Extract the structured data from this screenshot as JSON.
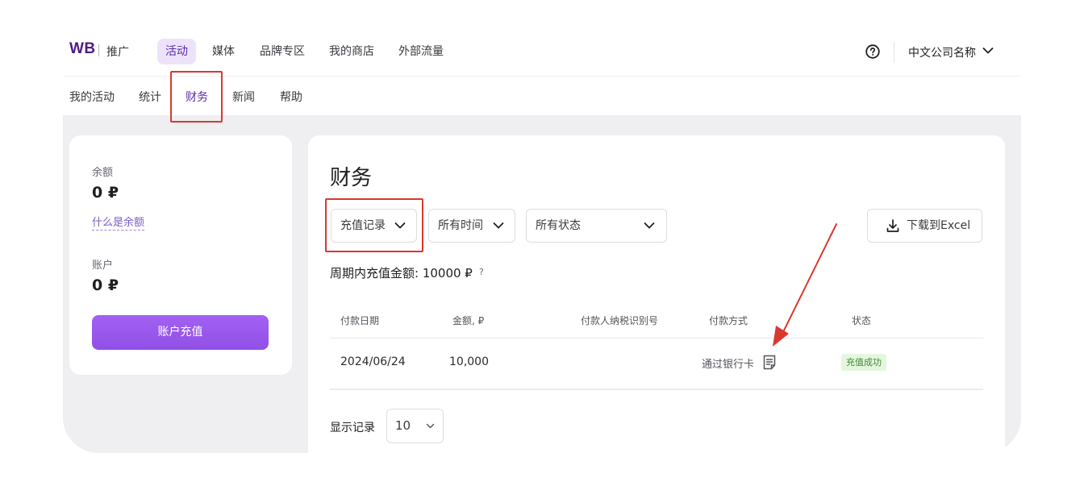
{
  "brand": {
    "logo": "WB",
    "sub": "推广"
  },
  "topnav": {
    "items": [
      {
        "label": "活动",
        "active": true
      },
      {
        "label": "媒体",
        "active": false
      },
      {
        "label": "品牌专区",
        "active": false
      },
      {
        "label": "我的商店",
        "active": false
      },
      {
        "label": "外部流量",
        "active": false
      }
    ],
    "help_icon": "question-circle-icon",
    "company": "中文公司名称",
    "company_icon": "chevron-down-icon"
  },
  "subnav": {
    "items": [
      {
        "label": "我的活动",
        "active": false
      },
      {
        "label": "统计",
        "active": false
      },
      {
        "label": "财务",
        "active": true
      },
      {
        "label": "新闻",
        "active": false
      },
      {
        "label": "帮助",
        "active": false
      }
    ]
  },
  "sidebar": {
    "balance_label": "余额",
    "balance_value": "0 ₽",
    "balance_link": "什么是余额",
    "account_label": "账户",
    "account_value": "0 ₽",
    "topup_button": "账户充值"
  },
  "finance": {
    "title": "财务",
    "filters": {
      "type": "充值记录",
      "time": "所有时间",
      "status": "所有状态"
    },
    "download_button": "下载到Excel",
    "download_icon": "download-icon",
    "period_total": "周期内充值金额: 10000 ₽",
    "period_help": "?",
    "table": {
      "headers": [
        "付款日期",
        "金额, ₽",
        "付款人纳税识别号",
        "付款方式",
        "状态"
      ],
      "rows": [
        {
          "date": "2024/06/24",
          "amount": "10,000",
          "tin": "",
          "method": "通过银行卡",
          "method_icon": "receipt-icon",
          "status": "充值成功"
        }
      ]
    },
    "page_size_label": "显示记录",
    "page_size": "10"
  },
  "colors": {
    "brand": "#4f1a86",
    "accent": "#9b59ee",
    "active_tab_bg": "#ece3fb",
    "annotation": "#d9382f",
    "success_bg": "#e5f6df",
    "success_text": "#3c8a2e"
  }
}
